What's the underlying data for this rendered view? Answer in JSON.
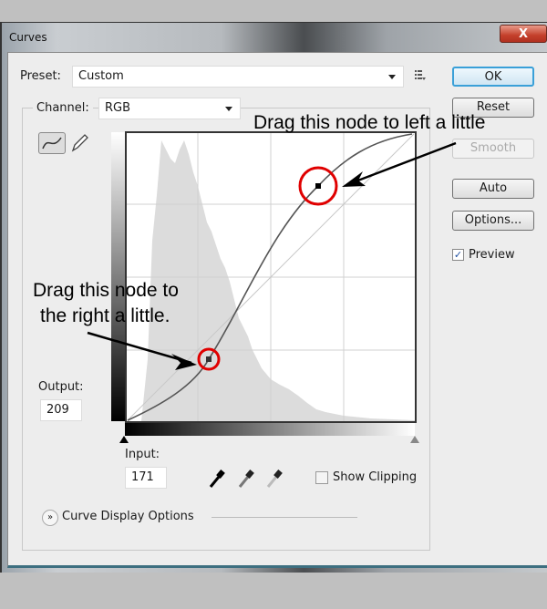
{
  "window": {
    "title": "Curves",
    "close_label": "X"
  },
  "preset": {
    "label": "Preset:",
    "value": "Custom"
  },
  "channel": {
    "label": "Channel:",
    "value": "RGB"
  },
  "buttons": {
    "ok": "OK",
    "reset": "Reset",
    "smooth": "Smooth",
    "auto": "Auto",
    "options": "Options..."
  },
  "preview": {
    "label": "Preview",
    "checked": true
  },
  "output": {
    "label": "Output:",
    "value": "209"
  },
  "input": {
    "label": "Input:",
    "value": "171"
  },
  "show_clipping": {
    "label": "Show Clipping",
    "checked": false
  },
  "curve_display_options": {
    "label": "Curve Display Options"
  },
  "annotations": {
    "top": "Drag this node to left a little",
    "bottom_line1": "Drag this node to",
    "bottom_line2": "the right a little."
  },
  "colors": {
    "highlight_circle": "#e00000",
    "ok_border": "#3aa0d8"
  },
  "icons": [
    "curve-tool-icon",
    "pencil-icon",
    "preset-menu-icon",
    "black-eyedropper-icon",
    "gray-eyedropper-icon",
    "white-eyedropper-icon",
    "expand-chevron-icon"
  ]
}
